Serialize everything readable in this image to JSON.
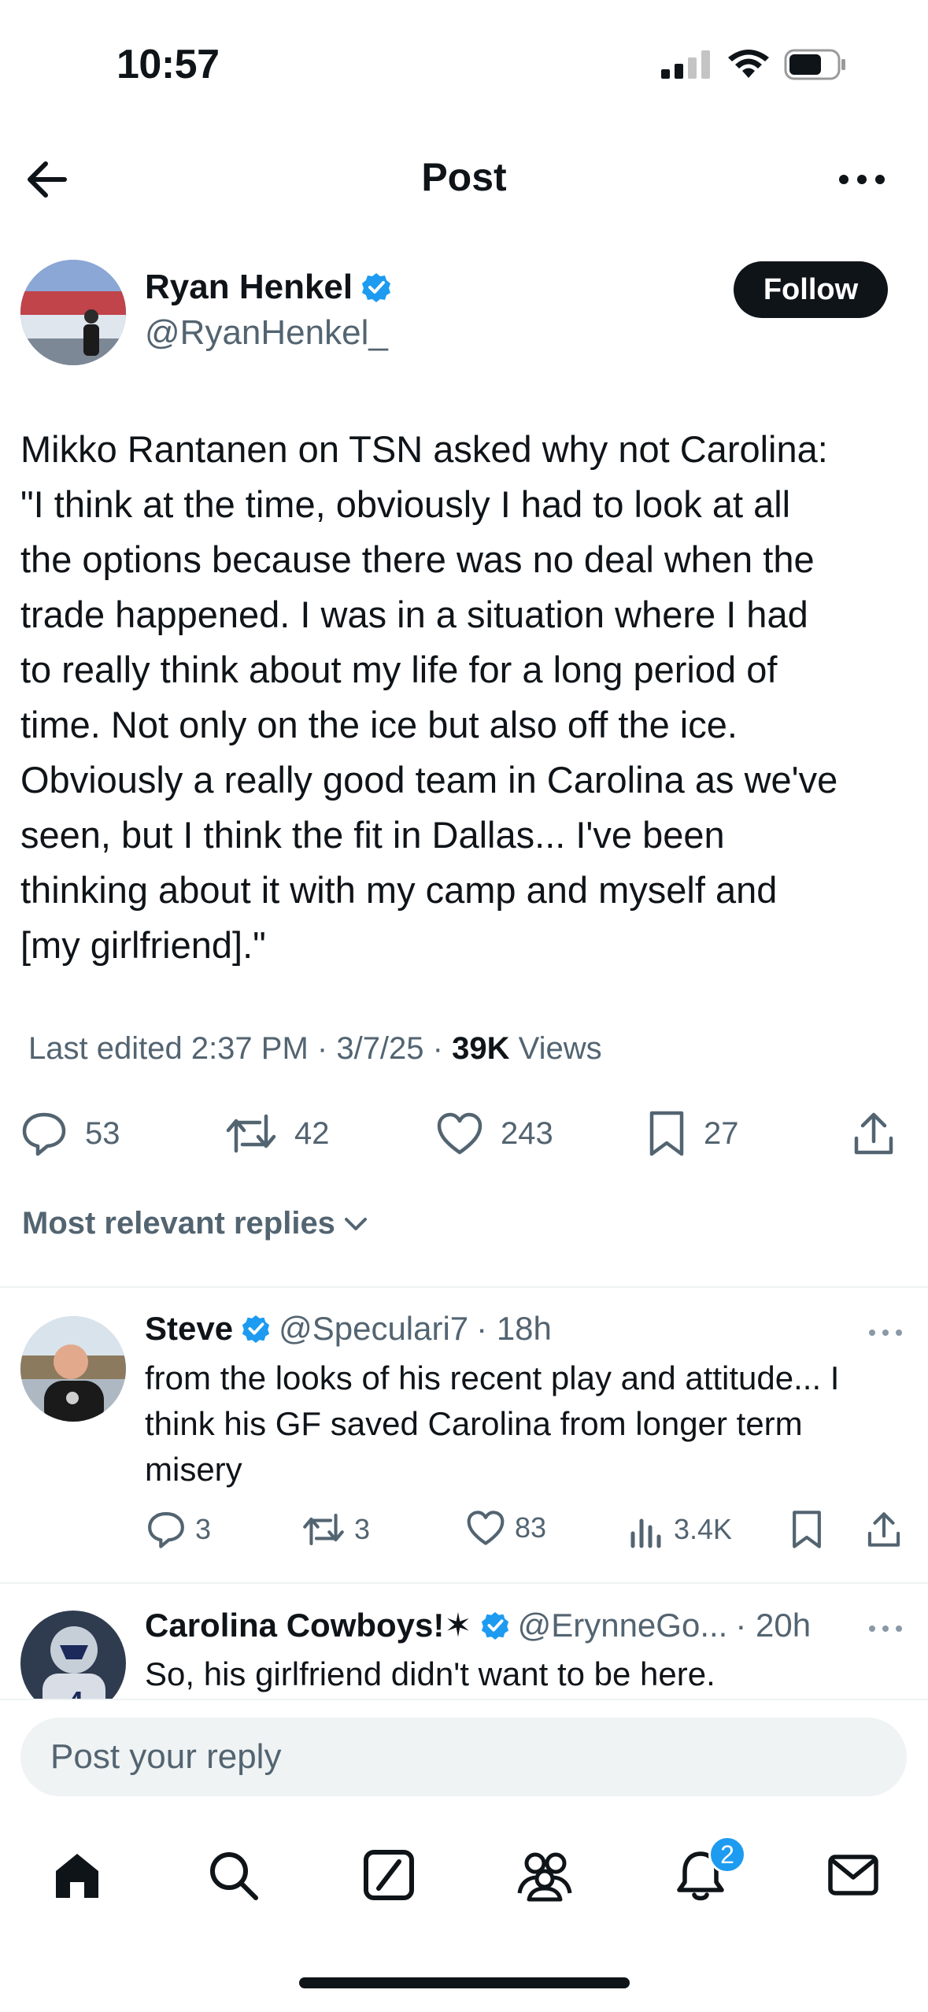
{
  "status_bar": {
    "time": "10:57"
  },
  "header": {
    "title": "Post"
  },
  "author": {
    "name": "Ryan Henkel",
    "handle": "@RyanHenkel_",
    "verified": true,
    "follow_label": "Follow"
  },
  "post": {
    "text": "Mikko Rantanen on TSN asked why not Carolina:\n\"I think at the time, obviously I had to look at all\nthe options because there was no deal when the\ntrade happened. I was in a situation where I had\nto really think about my life for a long period of\ntime. Not only on the ice but also off the ice.\nObviously a really good team in Carolina as we've\nseen, but I think the fit in Dallas... I've been\nthinking about it with my camp and myself and\n[my girlfriend].\"",
    "edited": "Last edited 2:37 PM · 3/7/25",
    "views_count": "39K",
    "views_label": "Views"
  },
  "actions": {
    "replies": "53",
    "reposts": "42",
    "likes": "243",
    "bookmarks": "27"
  },
  "sort_label": "Most relevant replies",
  "replies": [
    {
      "name": "Steve",
      "handle": "@Speculari7",
      "time": "· 18h",
      "text": "from the looks of his recent play and attitude... I think his GF saved Carolina from longer term misery",
      "replies": "3",
      "reposts": "3",
      "likes": "83",
      "views": "3.4K"
    },
    {
      "name": "Carolina Cowboys!✶",
      "handle": "@ErynneGo...",
      "time": "· 20h",
      "text": "So, his girlfriend didn't want to be here."
    }
  ],
  "composer": {
    "placeholder": "Post your reply"
  },
  "nav": {
    "notifications_badge": "2"
  },
  "colors": {
    "accent": "#1d9bf0",
    "text": "#0f1419",
    "muted": "#536471",
    "divider": "#eff3f4"
  }
}
